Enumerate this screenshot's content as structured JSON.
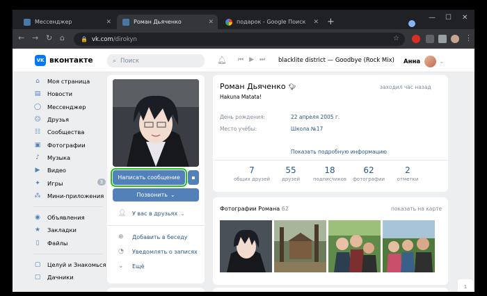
{
  "browser": {
    "tabs": [
      {
        "title": "Мессенджер"
      },
      {
        "title": "Роман Дьяченко"
      },
      {
        "title": "подарок - Google Поиск"
      }
    ],
    "url_host": "vk.com",
    "url_path": "/dirokyn"
  },
  "header": {
    "logo": "вконтакте",
    "logo_mark": "VK",
    "search_placeholder": "Поиск",
    "track": "blacklite district — Goodbye (Rock Mix)",
    "user_name": "Анна"
  },
  "menu": {
    "items": [
      {
        "label": "Моя страница",
        "icon": "home-icon"
      },
      {
        "label": "Новости",
        "icon": "news-icon"
      },
      {
        "label": "Мессенджер",
        "icon": "chat-icon"
      },
      {
        "label": "Друзья",
        "icon": "friends-icon"
      },
      {
        "label": "Сообщества",
        "icon": "groups-icon"
      },
      {
        "label": "Фотографии",
        "icon": "photo-icon"
      },
      {
        "label": "Музыка",
        "icon": "music-icon"
      },
      {
        "label": "Видео",
        "icon": "video-icon"
      },
      {
        "label": "Игры",
        "icon": "games-icon",
        "count": "3"
      },
      {
        "label": "Мини-приложения",
        "icon": "apps-icon"
      }
    ],
    "items2": [
      {
        "label": "Объявления",
        "icon": "ads-icon"
      },
      {
        "label": "Закладки",
        "icon": "bookmark-icon"
      },
      {
        "label": "Файлы",
        "icon": "file-icon"
      }
    ],
    "items3": [
      {
        "label": "Целуй и Знакомься",
        "icon": "app-icon"
      },
      {
        "label": "Дачники",
        "icon": "app-icon"
      }
    ]
  },
  "profile": {
    "write_message": "Написать сообщение",
    "call": "Позвонить",
    "friends_status": "У вас в друзьях",
    "add_to_chat": "Добавить в беседу",
    "notify": "Уведомлять о записях",
    "more": "Ещё",
    "name": "Роман Дьяченко",
    "status": "Hakuna Matata!",
    "last_seen": "заходил час назад",
    "birthday_label": "День рождения:",
    "birthday_value": "22 апреля 2005 г.",
    "school_label": "Место учёбы:",
    "school_value": "Школа №17",
    "more_info": "Показать подробную информацию",
    "counters": [
      {
        "num": "7",
        "label": "общих друзей"
      },
      {
        "num": "55",
        "label": "друзей"
      },
      {
        "num": "18",
        "label": "подписчиков"
      },
      {
        "num": "62",
        "label": "фотографии"
      },
      {
        "num": "2",
        "label": "отметки"
      }
    ]
  },
  "photos": {
    "title": "Фотографии Романа",
    "count": "62",
    "map_link": "показать на карте"
  },
  "chat_widget": {
    "count": "1"
  },
  "colors": {
    "vk_blue": "#5181b8",
    "link": "#2a5885",
    "highlight": "#22c31b"
  }
}
